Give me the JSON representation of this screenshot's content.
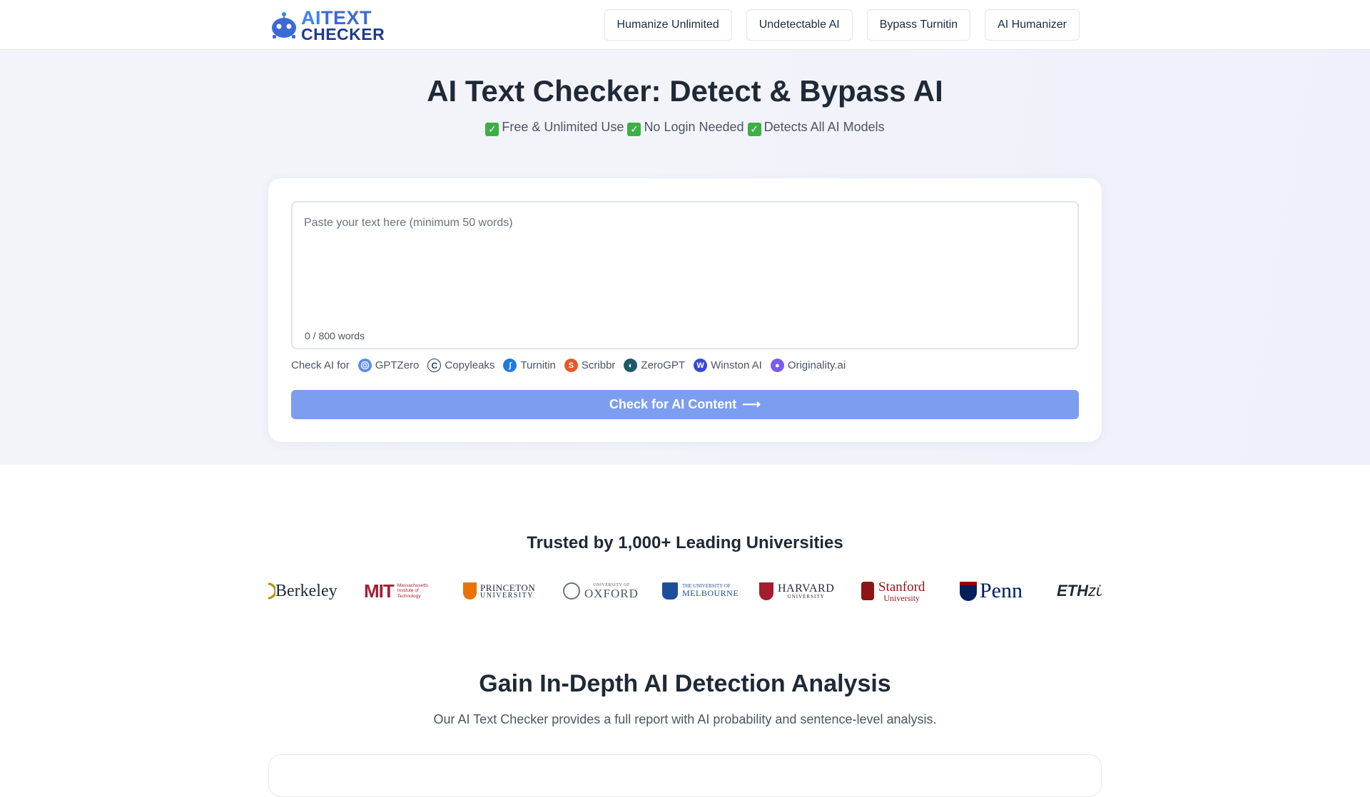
{
  "logo": {
    "line1_ai": "AI",
    "line1_rest": "TEXT",
    "line2": "CHECKER"
  },
  "nav": [
    {
      "label": "Humanize Unlimited"
    },
    {
      "label": "Undetectable AI"
    },
    {
      "label": "Bypass Turnitin"
    },
    {
      "label": "AI Humanizer"
    }
  ],
  "hero": {
    "title": "AI Text Checker: Detect & Bypass AI",
    "features": [
      "Free & Unlimited Use",
      "No Login Needed",
      "Detects All AI Models"
    ]
  },
  "checker": {
    "placeholder": "Paste your text here (minimum 50 words)",
    "word_count": "0 / 800 words",
    "detectors_label": "Check AI for",
    "detectors": [
      {
        "name": "GPTZero",
        "icon": "gptzero-icon",
        "color": "#5b8def"
      },
      {
        "name": "Copyleaks",
        "icon": "copyleaks-icon",
        "color": "#1f3b73"
      },
      {
        "name": "Turnitin",
        "icon": "turnitin-icon",
        "color": "#1f7ae0"
      },
      {
        "name": "Scribbr",
        "icon": "scribbr-icon",
        "color": "#e8572a"
      },
      {
        "name": "ZeroGPT",
        "icon": "zerogpt-icon",
        "color": "#1e5a66"
      },
      {
        "name": "Winston AI",
        "icon": "winston-icon",
        "color": "#3a47d5"
      },
      {
        "name": "Originality.ai",
        "icon": "originality-icon",
        "color": "#7a5cf0"
      }
    ],
    "button_label": "Check for AI Content",
    "button_color": "#7c9ef0"
  },
  "trusted": {
    "title": "Trusted by 1,000+ Leading Universities",
    "universities": {
      "berkeley": "Berkeley",
      "mit": "MIT",
      "mit_sub": [
        "Massachusetts",
        "Institute of",
        "Technology"
      ],
      "princeton": [
        "PRINCETON",
        "UNIVERSITY"
      ],
      "oxford": [
        "UNIVERSITY OF",
        "OXFORD"
      ],
      "melbourne": [
        "THE UNIVERSITY OF",
        "MELBOURNE"
      ],
      "harvard": [
        "HARVARD",
        "UNIVERSITY"
      ],
      "stanford": [
        "Stanford",
        "University"
      ],
      "penn": "Penn",
      "eth_bold": "ETH",
      "eth_rest": "züri"
    }
  },
  "analysis": {
    "title": "Gain In-Depth AI Detection Analysis",
    "subtitle": "Our AI Text Checker provides a full report with AI probability and sentence-level analysis."
  }
}
